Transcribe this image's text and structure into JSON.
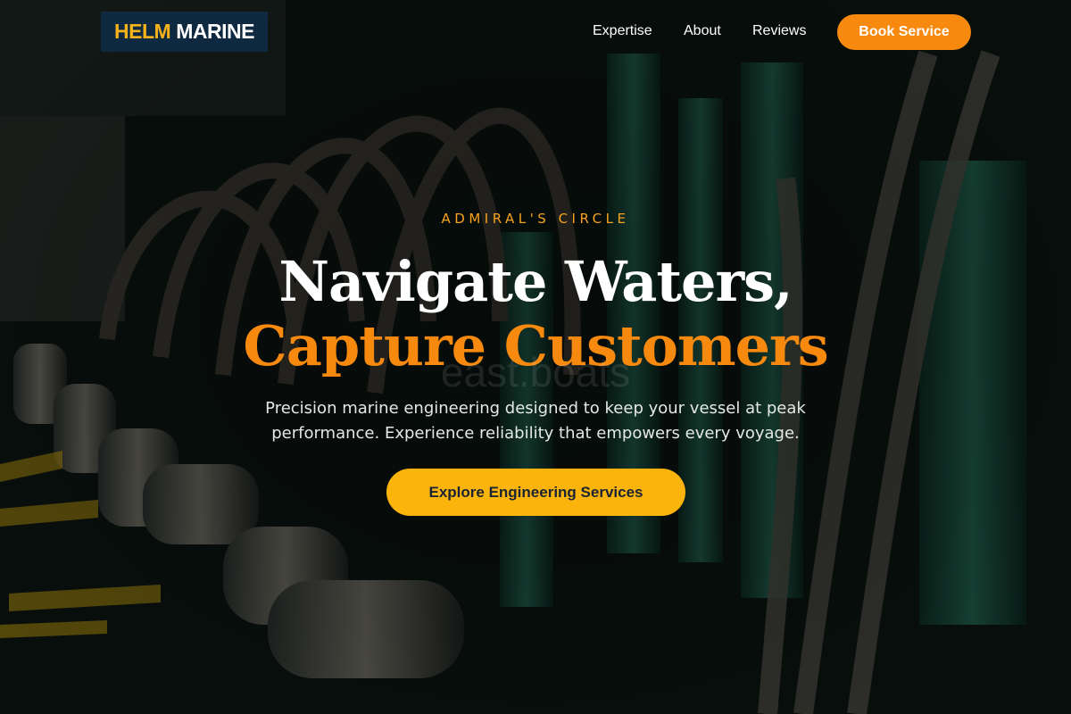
{
  "brand": {
    "name_part1": "HELM",
    "name_part2": "MARINE",
    "accent_color": "#f6b21a",
    "logo_bg": "#0f2a40"
  },
  "nav": {
    "links": [
      {
        "label": "Expertise"
      },
      {
        "label": "About"
      },
      {
        "label": "Reviews"
      }
    ],
    "cta_label": "Book Service",
    "cta_color": "#f7890f"
  },
  "hero": {
    "eyebrow": "ADMIRAL'S CIRCLE",
    "headline_line1": "Navigate Waters,",
    "headline_line2": "Capture Customers",
    "headline_accent_color": "#f7890f",
    "watermark": "east.boats",
    "subtitle": "Precision marine engineering designed to keep your vessel at peak performance. Experience reliability that empowers every voyage.",
    "cta_label": "Explore Engineering Services",
    "cta_color": "#fbb40c",
    "background": "engine-room-photo"
  }
}
